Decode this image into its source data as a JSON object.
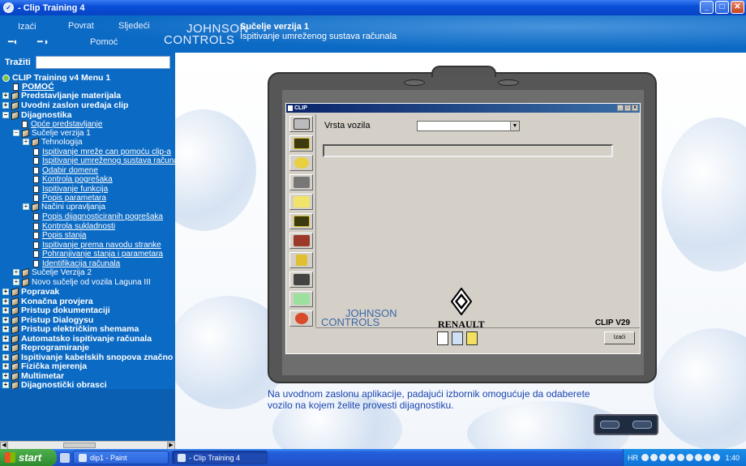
{
  "window": {
    "title": " - Clip Training 4"
  },
  "header": {
    "nav": {
      "exit": "Izaći",
      "back": "Povrat",
      "next": "Sljedeći",
      "help": "Pomoć"
    },
    "logo": {
      "line1": "JOHNSON",
      "line2": "CONTROLS"
    },
    "title": "Sučelje verzija 1",
    "subtitle": "Ispitivanje umreženog sustava računala"
  },
  "search": {
    "label": "Tražiti",
    "value": ""
  },
  "tree": {
    "root": "CLIP Training v4 Menu 1",
    "items": [
      "POMOĆ",
      "Predstavljanje materijala",
      "Uvodni zaslon uređaja clip",
      "Dijagnostika",
      "Opće predstavljanje",
      "Sučelje verzija 1",
      "Tehnologija",
      "Ispitivanje mreže can pomoću clip-a",
      "Ispitivanje umreženog sustava računala",
      "Odabir domene",
      "Kontrola pogrešaka",
      "Ispitivanje funkcija",
      "Popis parametara",
      "Načini upravljanja",
      "Popis dijagnosticiranih pogrešaka",
      "Kontrola sukladnosti",
      "Popis stanja",
      "Ispitivanje prema navodu stranke",
      "Pohranjivanje stanja i parametara",
      "Identifikacija računala",
      "Sučelje Verzija 2",
      "Novo sučelje od vozila Laguna III",
      "Popravak",
      "Konačna provjera",
      "Pristup dokumentaciji",
      "Pristup Dialogysu",
      "Pristup električkim shemama",
      "Automatsko ispitivanje računala",
      "Reprogramiranje",
      "Ispitivanje kabelskih snopova značno",
      "Fizička mjerenja",
      "Multimetar",
      "Dijagnostički obrasci"
    ]
  },
  "clip_window": {
    "title": "CLIP",
    "vehicle_label": "Vrsta vozila",
    "vehicle_value": "",
    "logo_line1": "JOHNSON",
    "logo_line2": "CONTROLS",
    "brand": "RENAULT",
    "version": "CLIP V29",
    "exit_button": "Izaći"
  },
  "caption": "Na uvodnom zaslonu aplikacije, padajući izbornik omogućuje da odaberete vozilo na kojem želite provesti dijagnostiku.",
  "taskbar": {
    "start": "start",
    "tasks": [
      "dip1 - Paint",
      "- Clip Training 4"
    ],
    "lang": "HR",
    "clock": "1:40"
  }
}
